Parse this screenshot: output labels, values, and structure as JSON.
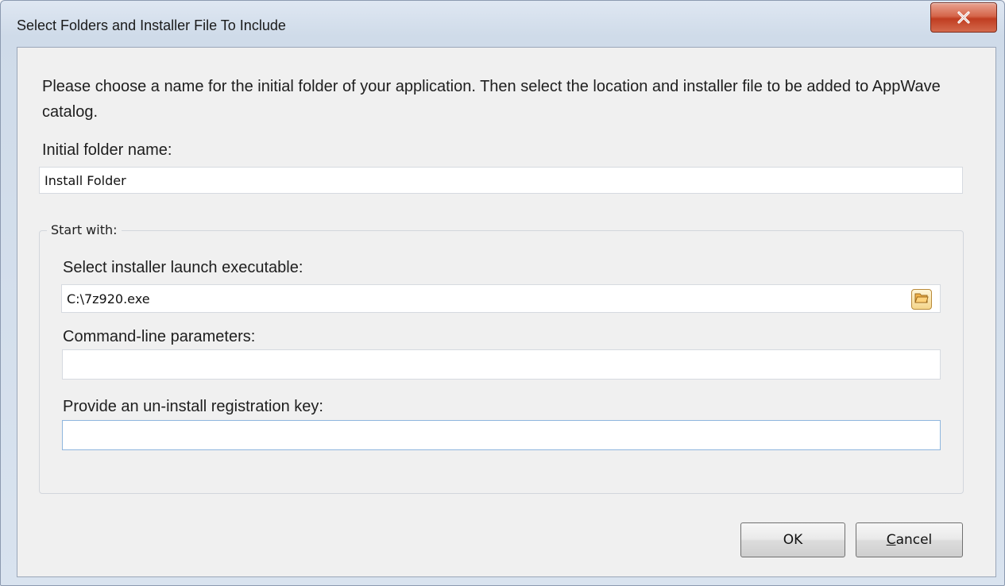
{
  "window": {
    "title": "Select Folders and Installer File To Include",
    "close_glyph": "x"
  },
  "dialog": {
    "description": "Please choose a name for the initial folder of your application. Then select the location and installer file to be added to AppWave catalog.",
    "initial_folder_label": "Initial folder name:",
    "initial_folder_value": "Install Folder",
    "group_title": "Start with:",
    "installer_label": "Select installer  launch executable:",
    "installer_value": "C:\\7z920.exe",
    "cmdline_label": "Command-line parameters:",
    "cmdline_value": "",
    "uninstall_label": "Provide an un-install registration key:",
    "uninstall_value": ""
  },
  "buttons": {
    "ok": "OK",
    "cancel_prefix": "C",
    "cancel_rest": "ancel"
  },
  "icons": {
    "close": "close-icon",
    "browse": "folder-icon"
  },
  "colors": {
    "close_button": "#c8462b",
    "field_focus_border": "#8fb6de",
    "browse_folder": "#e8a33a"
  }
}
